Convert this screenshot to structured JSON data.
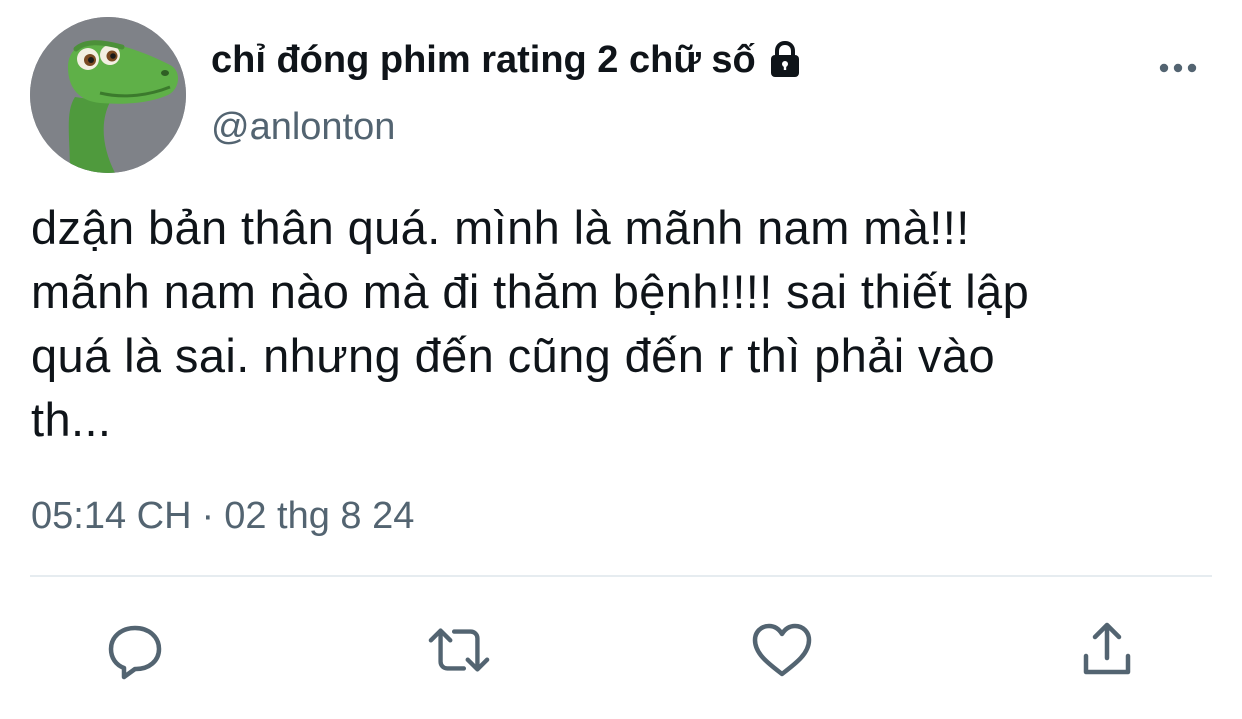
{
  "tweet": {
    "display_name": "chỉ đóng phim rating 2 chữ số",
    "handle": "@anlonton",
    "text": "dzận bản thân quá. mình là mãnh nam mà!!!\nmãnh nam nào mà đi thăm bệnh!!!! sai thiết lập\nquá là sai. nhưng đến cũng đến r thì phải vào\nth...",
    "time": "05:14 CH",
    "separator": "·",
    "date": "02 thg 8 24",
    "protected": true
  },
  "icons": {
    "lock": "lock-icon",
    "more": "more-icon",
    "reply": "reply-icon",
    "retweet": "retweet-icon",
    "like": "heart-icon",
    "share": "share-icon"
  },
  "colors": {
    "text": "#0f1419",
    "secondary": "#536471",
    "divider": "#e6ecf0"
  }
}
